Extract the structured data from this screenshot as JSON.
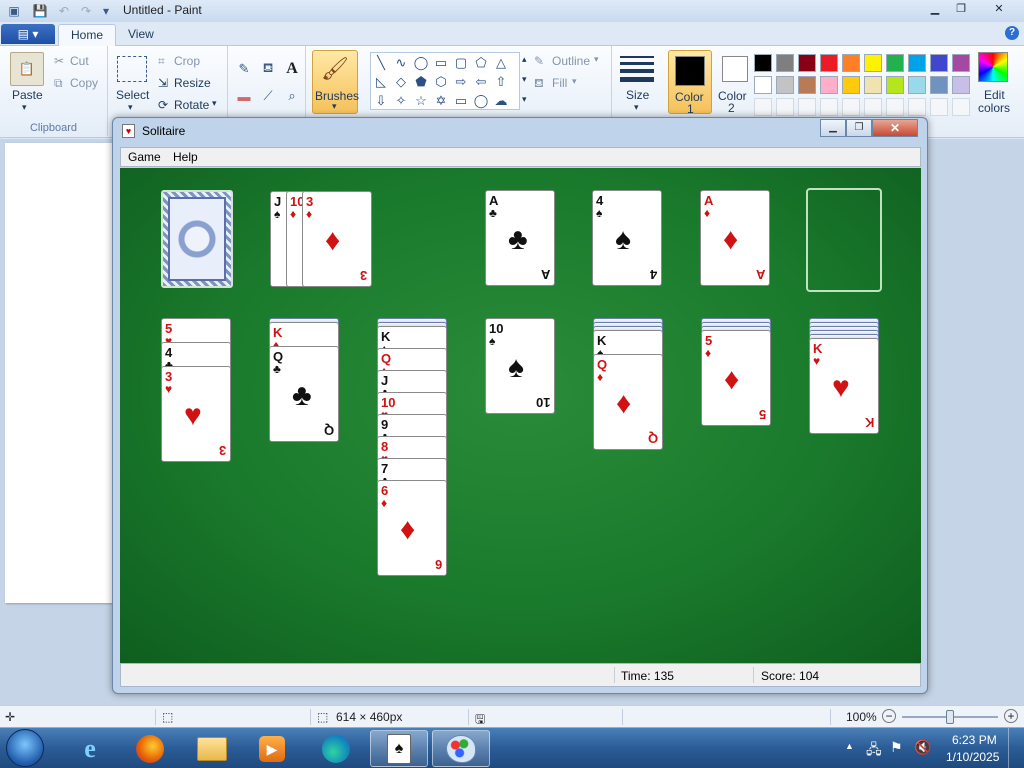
{
  "paint": {
    "title": "Untitled - Paint",
    "tabs": [
      "Home",
      "View"
    ],
    "clipboard": {
      "paste": "Paste",
      "cut": "Cut",
      "copy": "Copy",
      "group": "Clipboard"
    },
    "image": {
      "select": "Select",
      "crop": "Crop",
      "resize": "Resize",
      "rotate": "Rotate"
    },
    "brushes": "Brushes",
    "shapes": {
      "outline": "Outline",
      "fill": "Fill"
    },
    "size": "Size",
    "color1": {
      "label": "Color",
      "num": "1"
    },
    "color2": {
      "label": "Color",
      "num": "2"
    },
    "edit_colors": {
      "line1": "Edit",
      "line2": "colors"
    },
    "palette_row1": [
      "#000000",
      "#7f7f7f",
      "#880015",
      "#ed1c24",
      "#ff7f27",
      "#fff200",
      "#22b14c",
      "#00a2e8",
      "#3f48cc",
      "#a349a4"
    ],
    "palette_row2": [
      "#ffffff",
      "#c3c3c3",
      "#b97a57",
      "#ffaec9",
      "#ffc90e",
      "#efe4b0",
      "#b5e61d",
      "#99d9ea",
      "#7092be",
      "#c8bfe7"
    ],
    "status": {
      "dimensions": "614 × 460px",
      "zoom": "100%"
    }
  },
  "solitaire": {
    "title": "Solitaire",
    "menu": [
      "Game",
      "Help"
    ],
    "status": {
      "time": "Time: 135",
      "score": "Score: 104"
    },
    "waste": [
      "J",
      "10",
      "3"
    ],
    "foundations": [
      {
        "rank": "A",
        "suit": "♣"
      },
      {
        "rank": "4",
        "suit": "♠"
      },
      {
        "rank": "A",
        "suit": "♦"
      }
    ],
    "tableau": [
      {
        "cards": [
          "5",
          "4",
          "3"
        ],
        "suits": [
          "♥",
          "♣",
          "♥"
        ]
      },
      {
        "cards": [
          "K",
          "Q"
        ],
        "suits": [
          "♦",
          "♣"
        ]
      },
      {
        "cards": [
          "K",
          "Q",
          "J",
          "10",
          "9",
          "8",
          "7",
          "6"
        ],
        "suits": [
          "♠",
          "♦",
          "♣",
          "♥",
          "♣",
          "♥",
          "♣",
          "♦"
        ]
      },
      {
        "cards": [
          "10"
        ],
        "suits": [
          "♠"
        ]
      },
      {
        "cards": [
          "K",
          "Q"
        ],
        "suits": [
          "♠",
          "♦"
        ]
      },
      {
        "cards": [
          "5"
        ],
        "suits": [
          "♦"
        ]
      },
      {
        "cards": [
          "K"
        ],
        "suits": [
          "♥"
        ]
      }
    ]
  },
  "taskbar": {
    "time": "6:23 PM",
    "date": "1/10/2025",
    "apps": [
      "Internet Explorer",
      "Firefox",
      "Windows Explorer",
      "Media Player",
      "Edge",
      "Solitaire",
      "Paint"
    ]
  }
}
